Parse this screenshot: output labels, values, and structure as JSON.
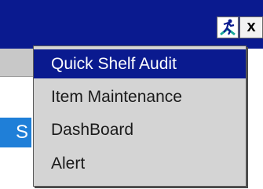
{
  "window": {
    "close_label": "x",
    "app_icon": "running-man-icon"
  },
  "left_panel": {
    "button_label": "S"
  },
  "menu": {
    "items": [
      {
        "label": "Quick Shelf Audit",
        "selected": true
      },
      {
        "label": "Item Maintenance",
        "selected": false
      },
      {
        "label": "DashBoard",
        "selected": false
      },
      {
        "label": "Alert",
        "selected": false
      }
    ]
  },
  "colors": {
    "title_bar": "#0a1a8f",
    "menu_background": "#d4d4d4",
    "selection": "#0a1a8f",
    "left_button": "#1f7fd8"
  }
}
